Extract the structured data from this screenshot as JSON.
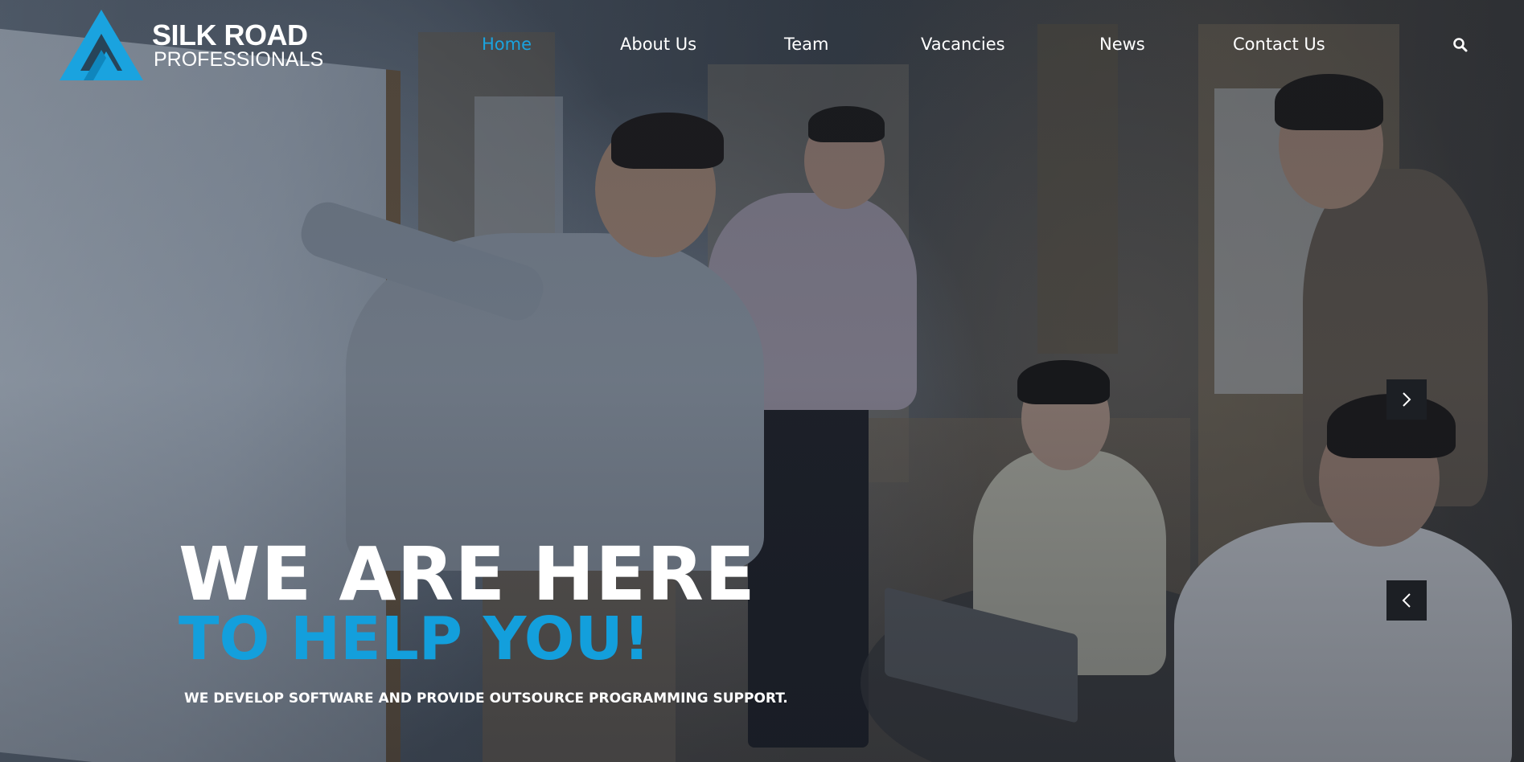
{
  "brand": {
    "title": "SILK ROAD",
    "subtitle": "PROFESSIONALS",
    "accent_color": "#1aa3df",
    "logo_icon": "triangle-logo-icon"
  },
  "nav": {
    "items": [
      {
        "label": "Home",
        "active": true
      },
      {
        "label": "About Us",
        "active": false
      },
      {
        "label": "Team",
        "active": false
      },
      {
        "label": "Vacancies",
        "active": false
      },
      {
        "label": "News",
        "active": false
      },
      {
        "label": "Contact Us",
        "active": false
      }
    ],
    "search_icon": "search-icon"
  },
  "hero": {
    "headline_line1": "WE ARE HERE",
    "headline_line2": "TO HELP YOU!",
    "tagline": "WE DEVELOP SOFTWARE AND PROVIDE OUTSOURCE PROGRAMMING SUPPORT.",
    "headline_accent_color": "#139fdc",
    "next_icon": "chevron-right-icon",
    "prev_icon": "chevron-left-icon"
  }
}
